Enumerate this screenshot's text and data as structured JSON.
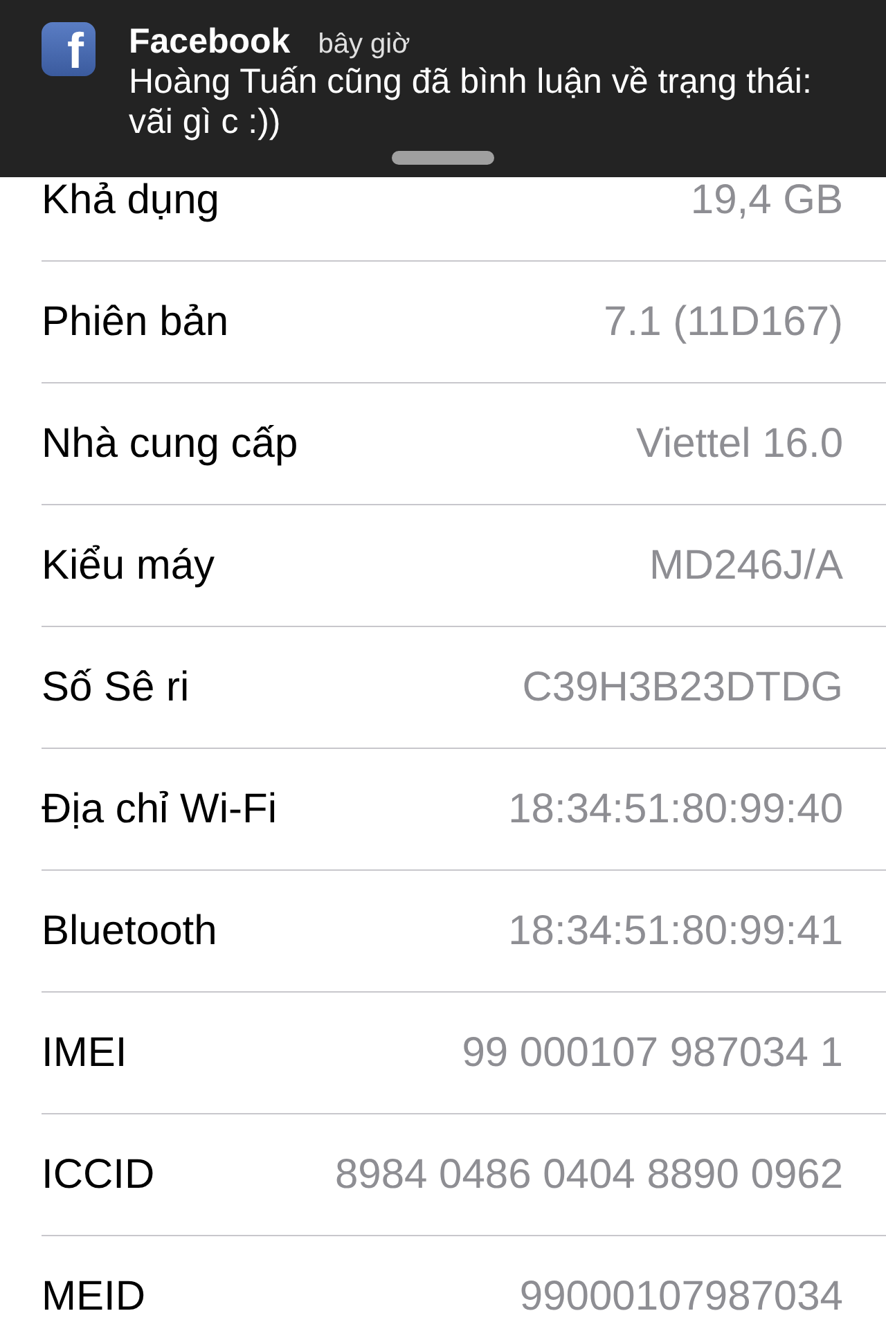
{
  "notification": {
    "app_icon_glyph": "f",
    "app": "Facebook",
    "time": "bây giờ",
    "message": "Hoàng Tuấn cũng đã bình luận về trạng thái: vãi gì c :))"
  },
  "rows": [
    {
      "label": "Khả dụng",
      "value": "19,4 GB"
    },
    {
      "label": "Phiên bản",
      "value": "7.1 (11D167)"
    },
    {
      "label": "Nhà cung cấp",
      "value": "Viettel 16.0"
    },
    {
      "label": "Kiểu máy",
      "value": "MD246J/A"
    },
    {
      "label": "Số Sê ri",
      "value": "C39H3B23DTDG"
    },
    {
      "label": "Địa chỉ Wi-Fi",
      "value": "18:34:51:80:99:40"
    },
    {
      "label": "Bluetooth",
      "value": "18:34:51:80:99:41"
    },
    {
      "label": "IMEI",
      "value": "99 000107 987034 1"
    },
    {
      "label": "ICCID",
      "value": "8984 0486 0404 8890 0962"
    },
    {
      "label": "MEID",
      "value": "99000107987034"
    }
  ]
}
